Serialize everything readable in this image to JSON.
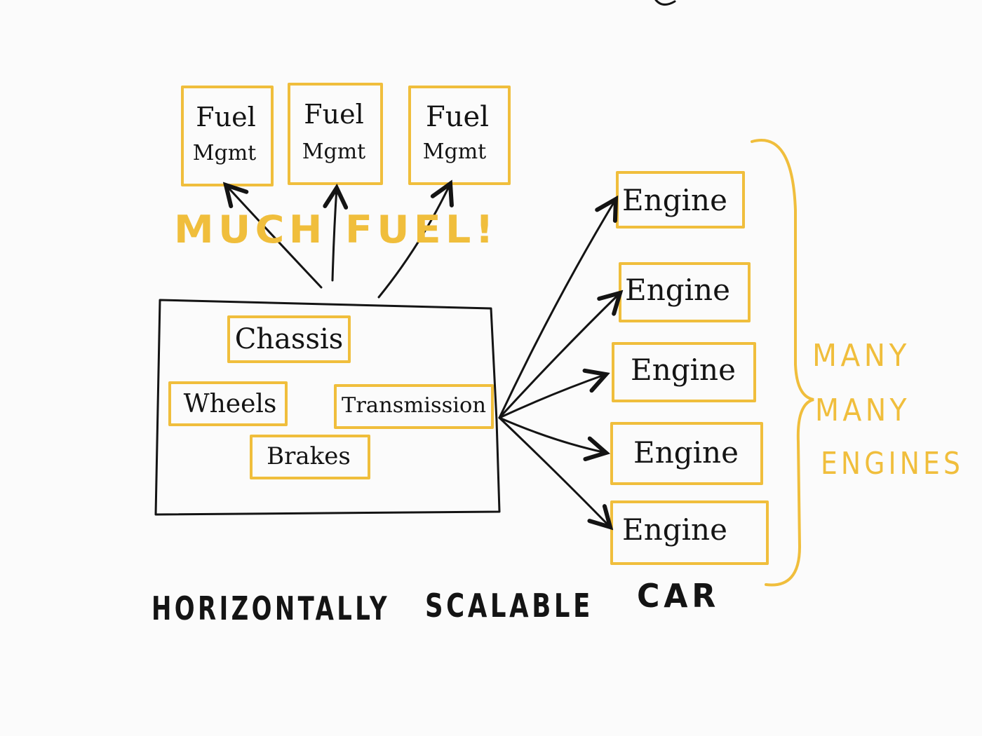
{
  "fuel_boxes": [
    "Fuel\nMgmt",
    "Fuel\nMgmt",
    "Fuel\nMgmt"
  ],
  "fuel_note": "MUCH FUEL!",
  "car_parts": {
    "chassis": "Chassis",
    "wheels": "Wheels",
    "transmission": "Transmission",
    "brakes": "Brakes"
  },
  "engines": [
    "Engine",
    "Engine",
    "Engine",
    "Engine",
    "Engine"
  ],
  "engine_note": [
    "MANY",
    "MANY",
    "ENGINES"
  ],
  "caption": [
    "HORIZONTALLY",
    "SCALABLE",
    "CAR"
  ],
  "colors": {
    "highlight": "#f0be3c",
    "ink": "#141414",
    "background": "#fbfbfb"
  }
}
